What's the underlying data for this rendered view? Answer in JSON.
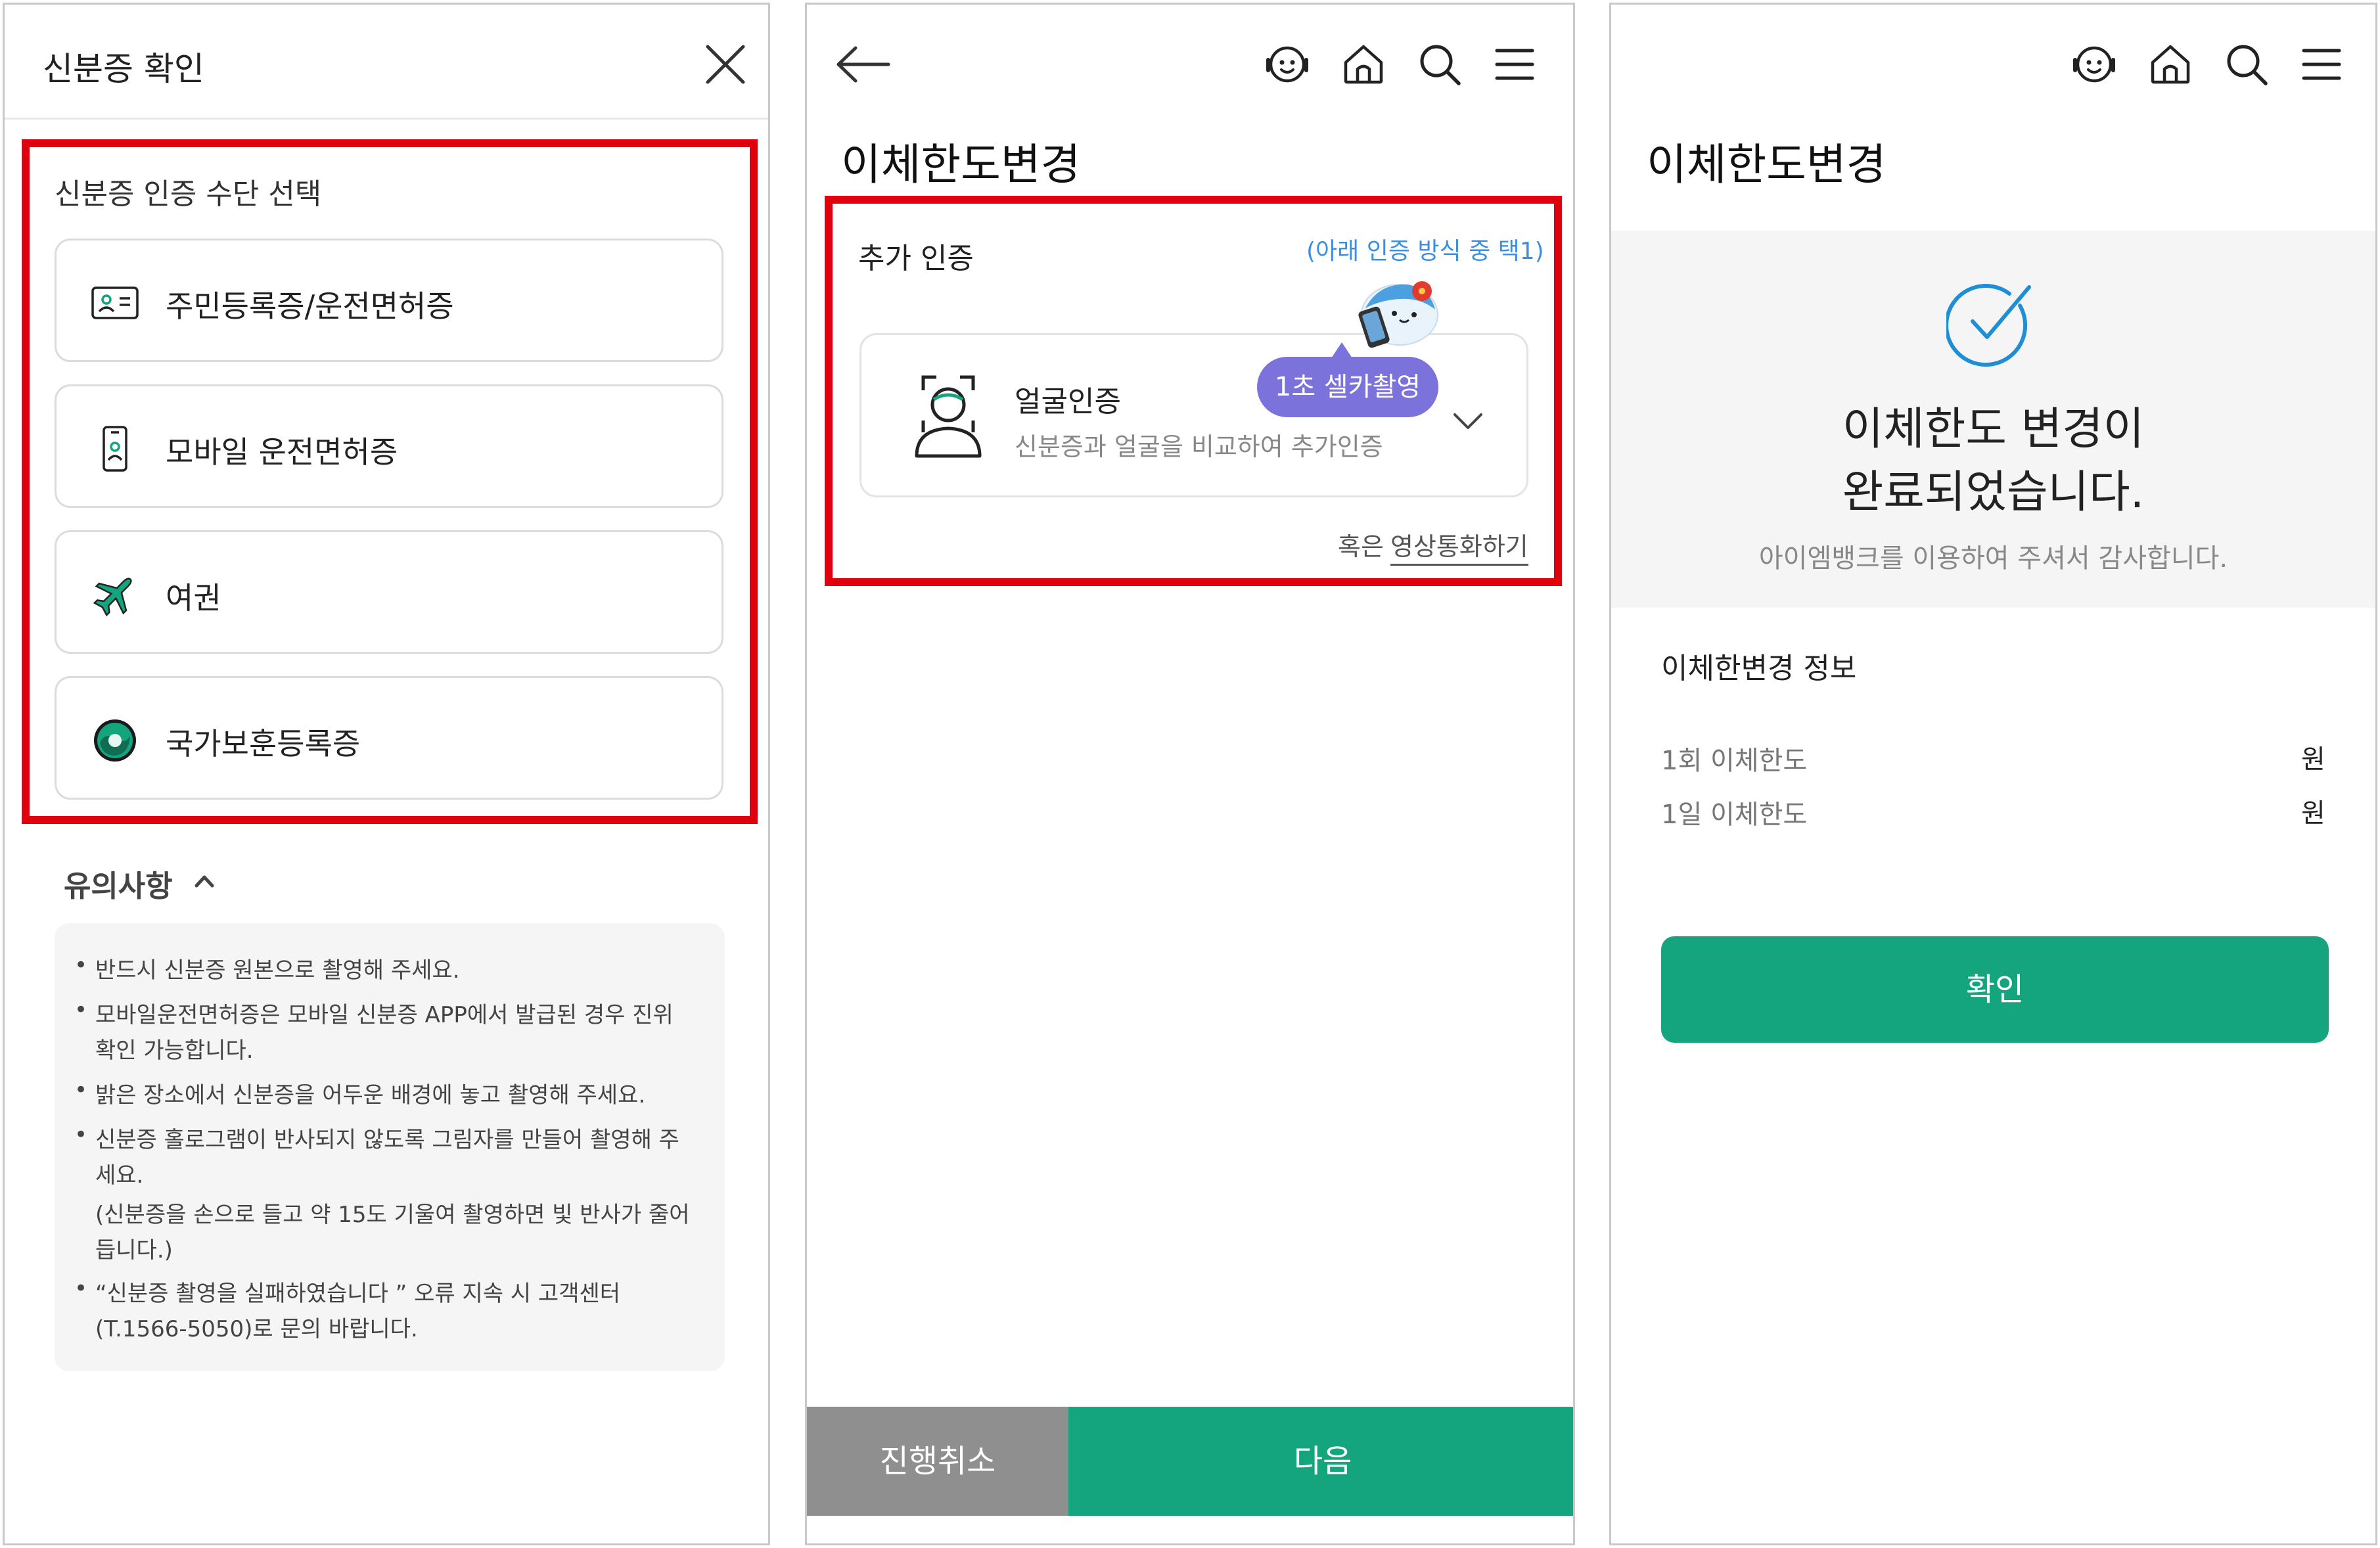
{
  "colors": {
    "highlight_red": "#e1000e",
    "brand_green": "#14a57f",
    "cancel_gray": "#8f8f8f",
    "pill_purple": "#7b72dc",
    "link_blue": "#3b8fe0"
  },
  "panel1": {
    "title": "신분증 확인",
    "close_icon": "close-icon",
    "section_title": "신분증 인증 수단 선택",
    "options": [
      {
        "label": "주민등록증/운전면허증",
        "icon": "id-card-icon"
      },
      {
        "label": "모바일 운전면허증",
        "icon": "mobile-license-icon"
      },
      {
        "label": "여권",
        "icon": "airplane-icon"
      },
      {
        "label": "국가보훈등록증",
        "icon": "veterans-emblem-icon"
      }
    ],
    "notice_title": "유의사항",
    "notice_lines": [
      "반드시 신분증 원본으로 촬영해 주세요.",
      "모바일운전면허증은 모바일 신분증 APP에서 발급된 경우 진위",
      "확인 가능합니다.",
      "밝은 장소에서 신분증을 어두운 배경에 놓고 촬영해 주세요.",
      "신분증 홀로그램이 반사되지 않도록 그림자를 만들어 촬영해 주",
      "세요.",
      "(신분증을 손으로 들고 약 15도 기울여 촬영하면 빛 반사가 줄어",
      "듭니다.)",
      "“신분증 촬영을 실패하였습니다 ” 오류 지속 시 고객센터",
      "(T.1566-5050)로 문의 바랍니다."
    ]
  },
  "panel2": {
    "page_title": "이체한도변경",
    "section_title": "추가 인증",
    "hint": "(아래 인증 방식 중 택1)",
    "method_title": "얼굴인증",
    "method_desc": "신분증과 얼굴을 비교하여 추가인증",
    "badge": "1초 셀카촬영",
    "alt_prefix": "혹은",
    "alt_link": "영상통화하기",
    "cancel_button": "진행취소",
    "next_button": "다음"
  },
  "panel3": {
    "page_title": "이체한도변경",
    "done_line1": "이체한도 변경이",
    "done_line2": "완료되었습니다.",
    "thanks": "아이엠뱅크를 이용하여 주셔서 감사합니다.",
    "info_title": "이체한변경 정보",
    "rows": [
      {
        "label": "1회 이체한도",
        "value": "원"
      },
      {
        "label": "1일 이체한도",
        "value": "원"
      }
    ],
    "confirm_button": "확인"
  }
}
